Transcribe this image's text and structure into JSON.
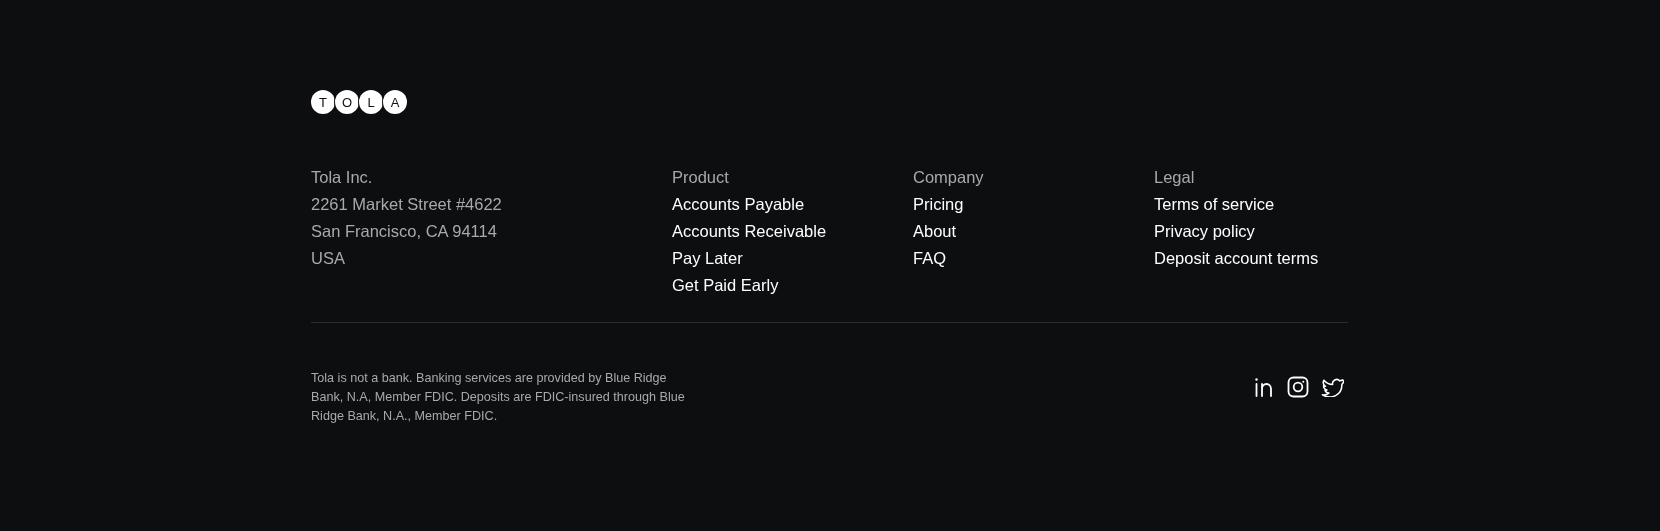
{
  "logo": {
    "letters": [
      "T",
      "O",
      "L",
      "A"
    ]
  },
  "address": {
    "lines": [
      "Tola Inc.",
      "2261 Market Street #4622",
      "San Francisco, CA 94114",
      "USA"
    ]
  },
  "columns": [
    {
      "heading": "Product",
      "links": [
        "Accounts Payable",
        "Accounts Receivable",
        "Pay Later",
        "Get Paid Early"
      ]
    },
    {
      "heading": "Company",
      "links": [
        "Pricing",
        "About",
        "FAQ"
      ]
    },
    {
      "heading": "Legal",
      "links": [
        "Terms of service",
        "Privacy policy",
        "Deposit account terms"
      ]
    }
  ],
  "disclaimer": "Tola is not a bank. Banking services are provided by Blue Ridge Bank, N.A, Member FDIC. Deposits are FDIC-insured through Blue Ridge Bank, N.A., Member FDIC.",
  "social": [
    {
      "kind": "linkedin"
    },
    {
      "kind": "instagram"
    },
    {
      "kind": "twitter"
    }
  ]
}
